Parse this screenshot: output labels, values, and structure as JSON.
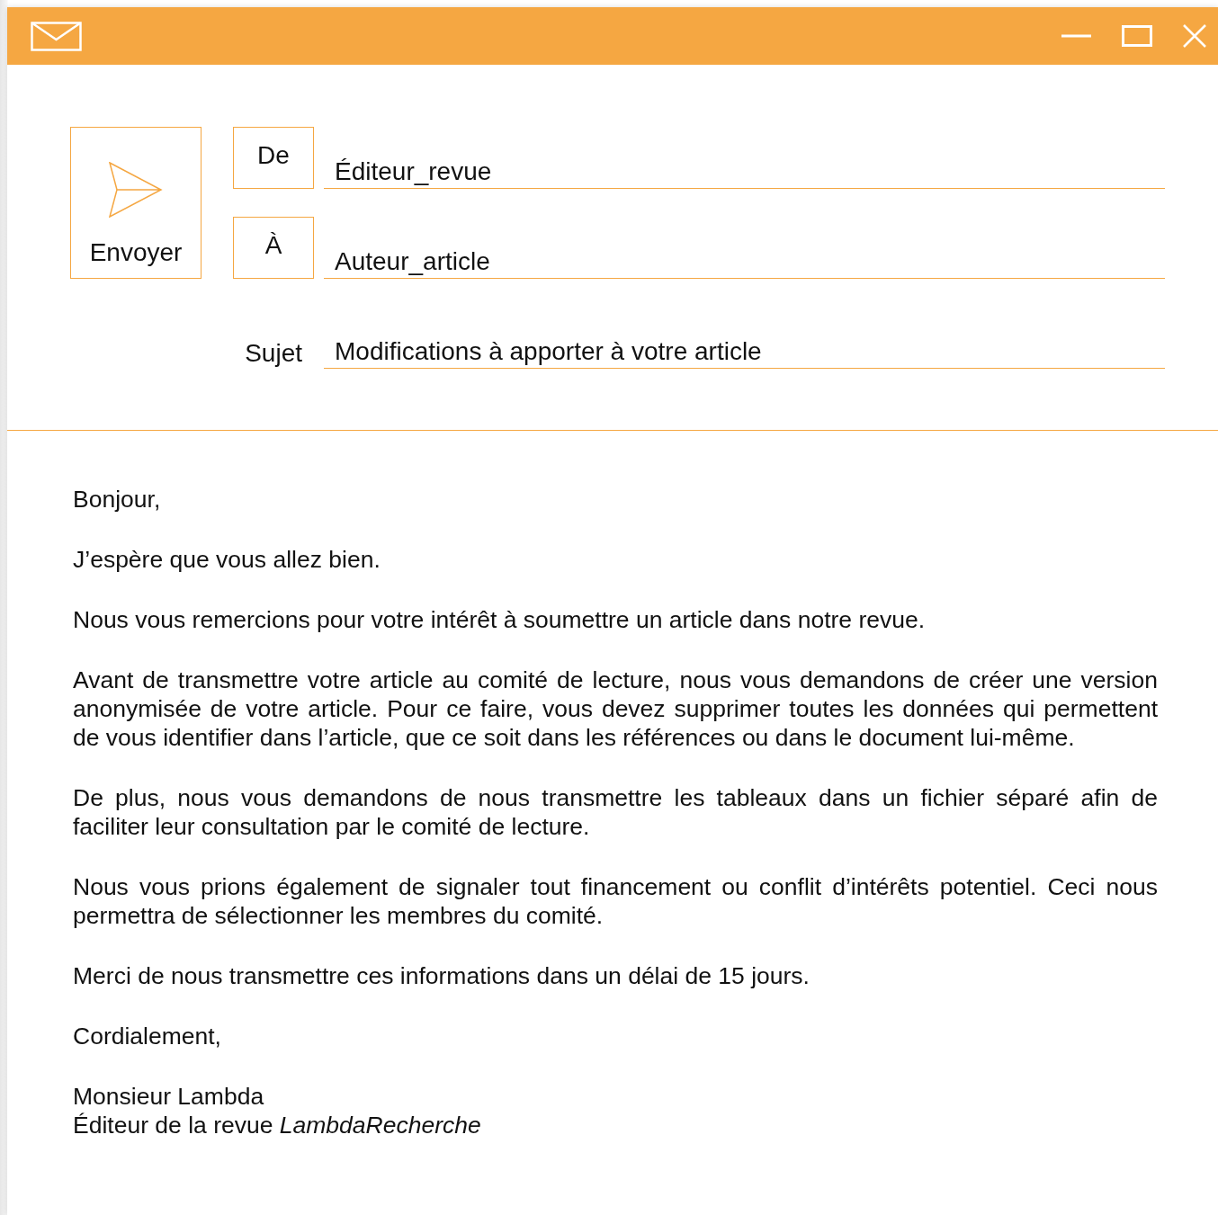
{
  "send_button": {
    "label": "Envoyer"
  },
  "fields": [
    {
      "kind": "button",
      "label": "De",
      "value": "Éditeur_revue"
    },
    {
      "kind": "button",
      "label": "À",
      "value": "Auteur_article"
    },
    {
      "kind": "plain",
      "label": "Sujet",
      "value": "Modifications à apporter à votre article"
    }
  ],
  "body": {
    "paragraphs": [
      "Bonjour,",
      "J’espère que vous allez bien.",
      "Nous vous remercions pour votre intérêt à soumettre un article dans notre revue.",
      "Avant de transmettre votre article au comité de lecture, nous vous demandons de créer une version anonymisée de votre article. Pour ce faire, vous devez supprimer toutes les données qui permettent de vous identifier dans l’article, que ce soit dans les références ou dans le document lui-même.",
      "De plus, nous vous demandons de nous transmettre les tableaux dans un fichier séparé afin de faciliter leur consultation par le comité de lecture.",
      "Nous vous prions également de signaler tout financement ou conflit d’intérêts potentiel. Ceci nous permettra de sélectionner les membres du comité.",
      "Merci de nous transmettre ces informations dans un délai de 15 jours.",
      "Cordialement,"
    ],
    "signature": [
      "Monsieur Lambda",
      "Éditeur de la revue *LambdaRecherche*"
    ]
  }
}
